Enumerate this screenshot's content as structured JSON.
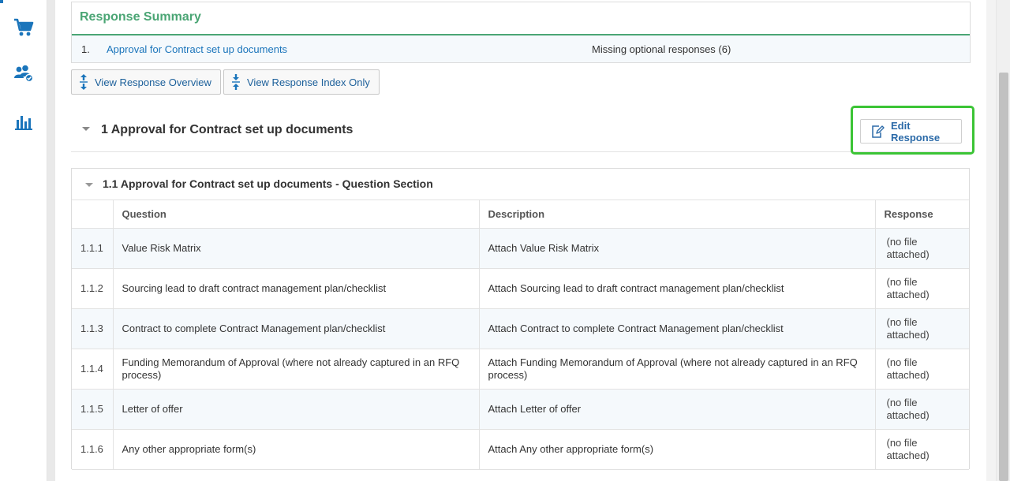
{
  "nav": {
    "icons": [
      "shopping-cart-icon",
      "users-check-icon",
      "bar-chart-icon"
    ]
  },
  "summary": {
    "title": "Response Summary",
    "row": {
      "number": "1.",
      "link": "Approval for Contract set up documents",
      "status": "Missing optional responses (6)"
    }
  },
  "toolbar": {
    "overview_label": "View Response Overview",
    "index_label": "View Response Index Only"
  },
  "section": {
    "title": "1 Approval for Contract set up documents",
    "edit_label": "Edit Response"
  },
  "question_section": {
    "title": "1.1 Approval for Contract set up documents - Question Section",
    "columns": {
      "number": "",
      "question": "Question",
      "description": "Description",
      "response": "Response"
    },
    "rows": [
      {
        "number": "1.1.1",
        "question": "Value Risk Matrix",
        "description": "Attach Value Risk Matrix",
        "response": "(no file attached)"
      },
      {
        "number": "1.1.2",
        "question": "Sourcing lead to draft contract management plan/checklist",
        "description": "Attach Sourcing lead to draft contract management plan/checklist",
        "response": "(no file attached)"
      },
      {
        "number": "1.1.3",
        "question": "Contract to complete Contract Management plan/checklist",
        "description": "Attach Contract to complete Contract Management plan/checklist",
        "response": "(no file attached)"
      },
      {
        "number": "1.1.4",
        "question": "Funding Memorandum of Approval (where not already captured in an RFQ process)",
        "description": "Attach Funding Memorandum of Approval (where not already captured in an RFQ process)",
        "response": "(no file attached)"
      },
      {
        "number": "1.1.5",
        "question": "Letter of offer",
        "description": "Attach Letter of offer",
        "response": "(no file attached)"
      },
      {
        "number": "1.1.6",
        "question": "Any other appropriate form(s)",
        "description": "Attach Any other appropriate form(s)",
        "response": "(no file attached)"
      }
    ]
  },
  "colors": {
    "accent_green": "#4aa574",
    "link_blue": "#1b75bb",
    "highlight_green": "#3bc435",
    "row_tint": "#f5f9fc"
  }
}
